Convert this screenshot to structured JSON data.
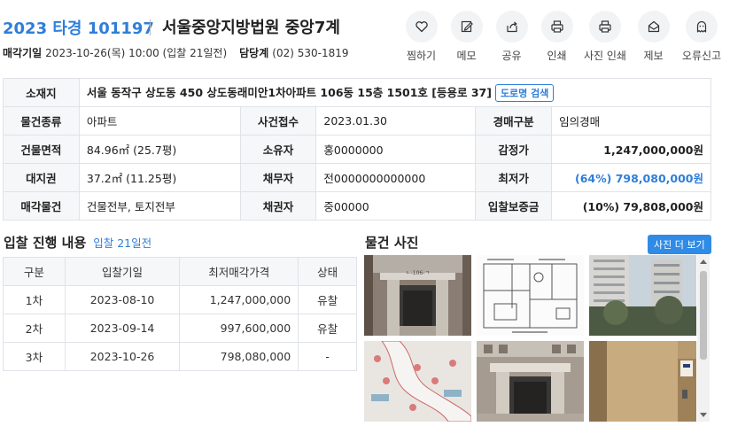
{
  "header": {
    "case_number": "2023 타경 101197",
    "court": "서울중앙지방법원 중앙7계",
    "sale_date_label": "매각기일",
    "sale_date_value": "2023-10-26(목) 10:00 (입찰 21일전)",
    "dept_label": "담당계",
    "dept_value": "(02) 530-1819"
  },
  "actions": [
    {
      "label": "찜하기",
      "icon": "heart-icon"
    },
    {
      "label": "메모",
      "icon": "memo-icon"
    },
    {
      "label": "공유",
      "icon": "share-icon"
    },
    {
      "label": "인쇄",
      "icon": "print-icon"
    },
    {
      "label": "사진 인쇄",
      "icon": "photo-print-icon"
    },
    {
      "label": "제보",
      "icon": "report-icon"
    },
    {
      "label": "오류신고",
      "icon": "ghost-icon"
    }
  ],
  "info": {
    "location_label": "소재지",
    "location_value": "서울 동작구 상도동 450 상도동래미안1차아파트 106동 15층 1501호 [등용로 37]",
    "road_search": "도로명 검색",
    "type_label": "물건종류",
    "type_value": "아파트",
    "filed_label": "사건접수",
    "filed_value": "2023.01.30",
    "auction_label": "경매구분",
    "auction_value": "임의경매",
    "building_label": "건물면적",
    "building_value": "84.96㎡ (25.7평)",
    "owner_label": "소유자",
    "owner_value": "홍0000000",
    "appraisal_label": "감정가",
    "appraisal_value": "1,247,000,000원",
    "land_label": "대지권",
    "land_value": "37.2㎡ (11.25평)",
    "debtor_label": "채무자",
    "debtor_value": "전0000000000000",
    "minimum_label": "최저가",
    "minimum_value": "(64%) 798,080,000원",
    "sale_item_label": "매각물건",
    "sale_item_value": "건물전부, 토지전부",
    "creditor_label": "채권자",
    "creditor_value": "중00000",
    "deposit_label": "입찰보증금",
    "deposit_value": "(10%) 79,808,000원"
  },
  "bidding": {
    "title": "입찰 진행 내용",
    "subtitle": "입찰 21일전",
    "columns": [
      "구분",
      "입찰기일",
      "최저매각가격",
      "상태"
    ],
    "rows": [
      [
        "1차",
        "2023-08-10",
        "1,247,000,000",
        "유찰"
      ],
      [
        "2차",
        "2023-09-14",
        "997,600,000",
        "유찰"
      ],
      [
        "3차",
        "2023-10-26",
        "798,080,000",
        "-"
      ]
    ]
  },
  "photos": {
    "title": "물건 사진",
    "more_button": "사진 더 보기",
    "items": [
      "entrance",
      "floor-plan",
      "towers",
      "site-map",
      "entrance-2",
      "elevator"
    ],
    "entrance_sign": "ㄴ-106-ㄱ"
  }
}
